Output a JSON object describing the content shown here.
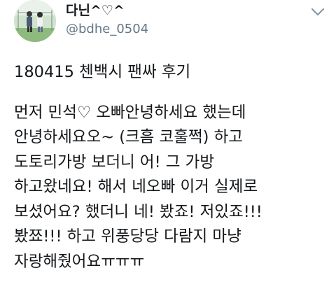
{
  "author": {
    "display_name": "다닌^♡^",
    "handle": "@bdhe_0504",
    "avatar_icon": "profile-photo-avatar"
  },
  "menu": {
    "icon": "chevron-down-icon"
  },
  "tweet": {
    "title": "180415 첸백시 팬싸 후기",
    "lines": [
      "먼저 민석♡ 오빠안녕하세요 했는데",
      "안녕하세요오~ (크흠 코훌쩍) 하고",
      "도토리가방 보더니 어! 그 가방",
      "하고왔네요! 해서 네오빠 이거 실제로",
      "보셨어요? 했더니 네! 봤죠! 저있죠!!!",
      "봤쬬!!! 하고 위풍당당 다람지 마냥",
      "자랑해줬어요ㅠㅠㅠ"
    ]
  },
  "colors": {
    "text_primary": "#14171a",
    "text_secondary": "#657786",
    "background": "#ffffff"
  }
}
